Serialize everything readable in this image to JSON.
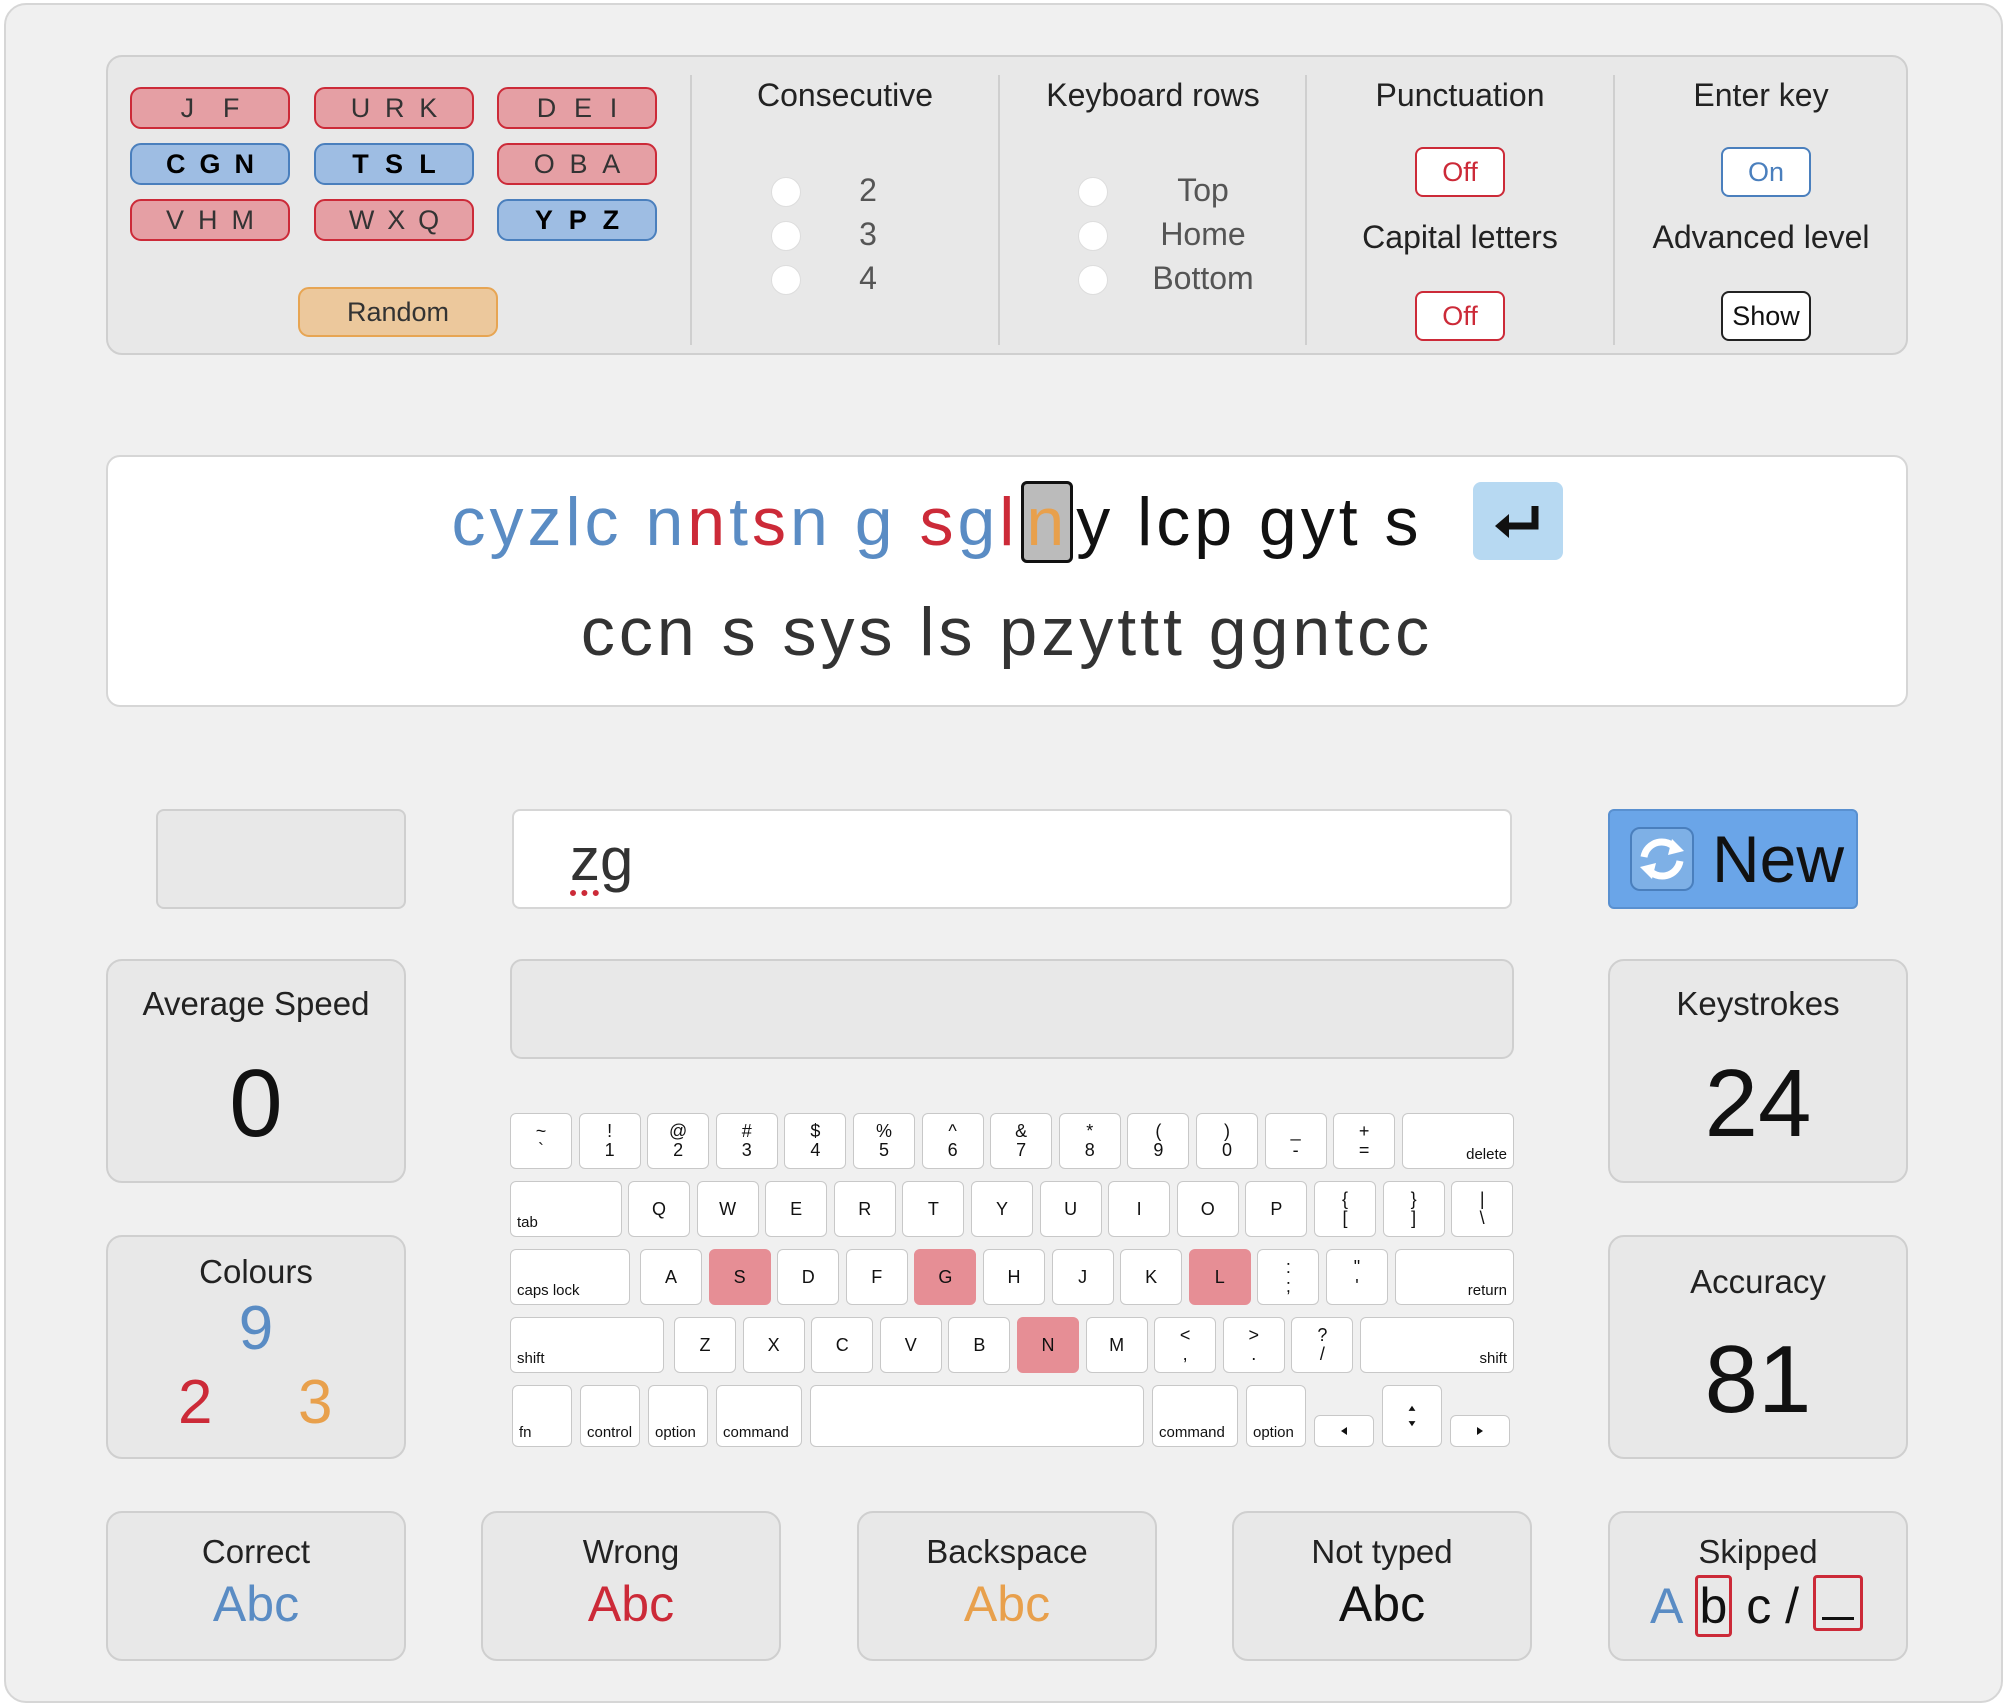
{
  "letter_groups": [
    {
      "letters": [
        "J",
        "F"
      ],
      "state": "red"
    },
    {
      "letters": [
        "U",
        "R",
        "K"
      ],
      "state": "red"
    },
    {
      "letters": [
        "D",
        "E",
        "I"
      ],
      "state": "red"
    },
    {
      "letters": [
        "C",
        "G",
        "N"
      ],
      "state": "blue"
    },
    {
      "letters": [
        "T",
        "S",
        "L"
      ],
      "state": "blue"
    },
    {
      "letters": [
        "O",
        "B",
        "A"
      ],
      "state": "red"
    },
    {
      "letters": [
        "V",
        "H",
        "M"
      ],
      "state": "red"
    },
    {
      "letters": [
        "W",
        "X",
        "Q"
      ],
      "state": "red"
    },
    {
      "letters": [
        "Y",
        "P",
        "Z"
      ],
      "state": "blue"
    }
  ],
  "random_label": "Random",
  "consecutive": {
    "title": "Consecutive",
    "options": [
      "2",
      "3",
      "4"
    ]
  },
  "keyboard_rows": {
    "title": "Keyboard rows",
    "options": [
      "Top",
      "Home",
      "Bottom"
    ]
  },
  "punctuation": {
    "title": "Punctuation",
    "value": "Off"
  },
  "capital_letters": {
    "title": "Capital letters",
    "value": "Off"
  },
  "enter_key": {
    "title": "Enter key",
    "value": "On"
  },
  "advanced_level": {
    "title": "Advanced level",
    "value": "Show"
  },
  "text_line1": [
    {
      "t": "cyzlc ",
      "c": "blue"
    },
    {
      "t": "n",
      "c": "blue"
    },
    {
      "t": "n",
      "c": "red"
    },
    {
      "t": "t",
      "c": "blue"
    },
    {
      "t": "s",
      "c": "red"
    },
    {
      "t": "n ",
      "c": "blue"
    },
    {
      "t": "g ",
      "c": "blue"
    },
    {
      "t": "s",
      "c": "red"
    },
    {
      "t": "g",
      "c": "blue"
    },
    {
      "t": "l",
      "c": "red"
    },
    {
      "t": "n",
      "c": "orange",
      "cursor": true
    },
    {
      "t": "y lcp gyt s",
      "c": "black"
    }
  ],
  "text_line2": "ccn s sys ls pzyttt ggntcc",
  "typed_input": "zg",
  "new_button_label": "New",
  "average_speed": {
    "label": "Average Speed",
    "value": "0"
  },
  "keystrokes": {
    "label": "Keystrokes",
    "value": "24"
  },
  "colours": {
    "label": "Colours",
    "blue": "9",
    "red": "2",
    "orange": "3"
  },
  "accuracy": {
    "label": "Accuracy",
    "value": "81"
  },
  "legend": {
    "correct": {
      "label": "Correct",
      "sample": "Abc"
    },
    "wrong": {
      "label": "Wrong",
      "sample": "Abc"
    },
    "backspace": {
      "label": "Backspace",
      "sample": "Abc"
    },
    "not_typed": {
      "label": "Not typed",
      "sample": "Abc"
    },
    "skipped": {
      "label": "Skipped",
      "a": "A",
      "b": "b",
      "c": "c",
      "slash": "/"
    }
  },
  "keyboard": {
    "row1": [
      [
        "~",
        "`"
      ],
      [
        "!",
        "1"
      ],
      [
        "@",
        "2"
      ],
      [
        "#",
        "3"
      ],
      [
        "$",
        "4"
      ],
      [
        "%",
        "5"
      ],
      [
        "^",
        "6"
      ],
      [
        "&",
        "7"
      ],
      [
        "*",
        "8"
      ],
      [
        "(",
        "9"
      ],
      [
        ")",
        "0"
      ],
      [
        "_",
        "-"
      ],
      [
        "+",
        "="
      ]
    ],
    "delete": "delete",
    "tab": "tab",
    "row2": [
      "Q",
      "W",
      "E",
      "R",
      "T",
      "Y",
      "U",
      "I",
      "O",
      "P"
    ],
    "row2_punct": [
      [
        "{",
        "["
      ],
      [
        "}",
        "]"
      ],
      [
        "|",
        "\\"
      ]
    ],
    "caps": "caps lock",
    "row3": [
      "A",
      "S",
      "D",
      "F",
      "G",
      "H",
      "J",
      "K",
      "L"
    ],
    "row3_punct": [
      [
        ":",
        ";"
      ],
      [
        "\"",
        "'"
      ]
    ],
    "return": "return",
    "shift": "shift",
    "row4": [
      "Z",
      "X",
      "C",
      "V",
      "B",
      "N",
      "M"
    ],
    "row4_punct": [
      [
        "<",
        ","
      ],
      [
        ">",
        "."
      ],
      [
        "?",
        "/"
      ]
    ],
    "fn": "fn",
    "control": "control",
    "option": "option",
    "command": "command",
    "highlighted": [
      "S",
      "G",
      "L",
      "N"
    ]
  },
  "colors": {
    "blue": "#5a8cc4",
    "red": "#cc2a38",
    "orange": "#e8a04c",
    "new_button": "#6aa5e8"
  }
}
